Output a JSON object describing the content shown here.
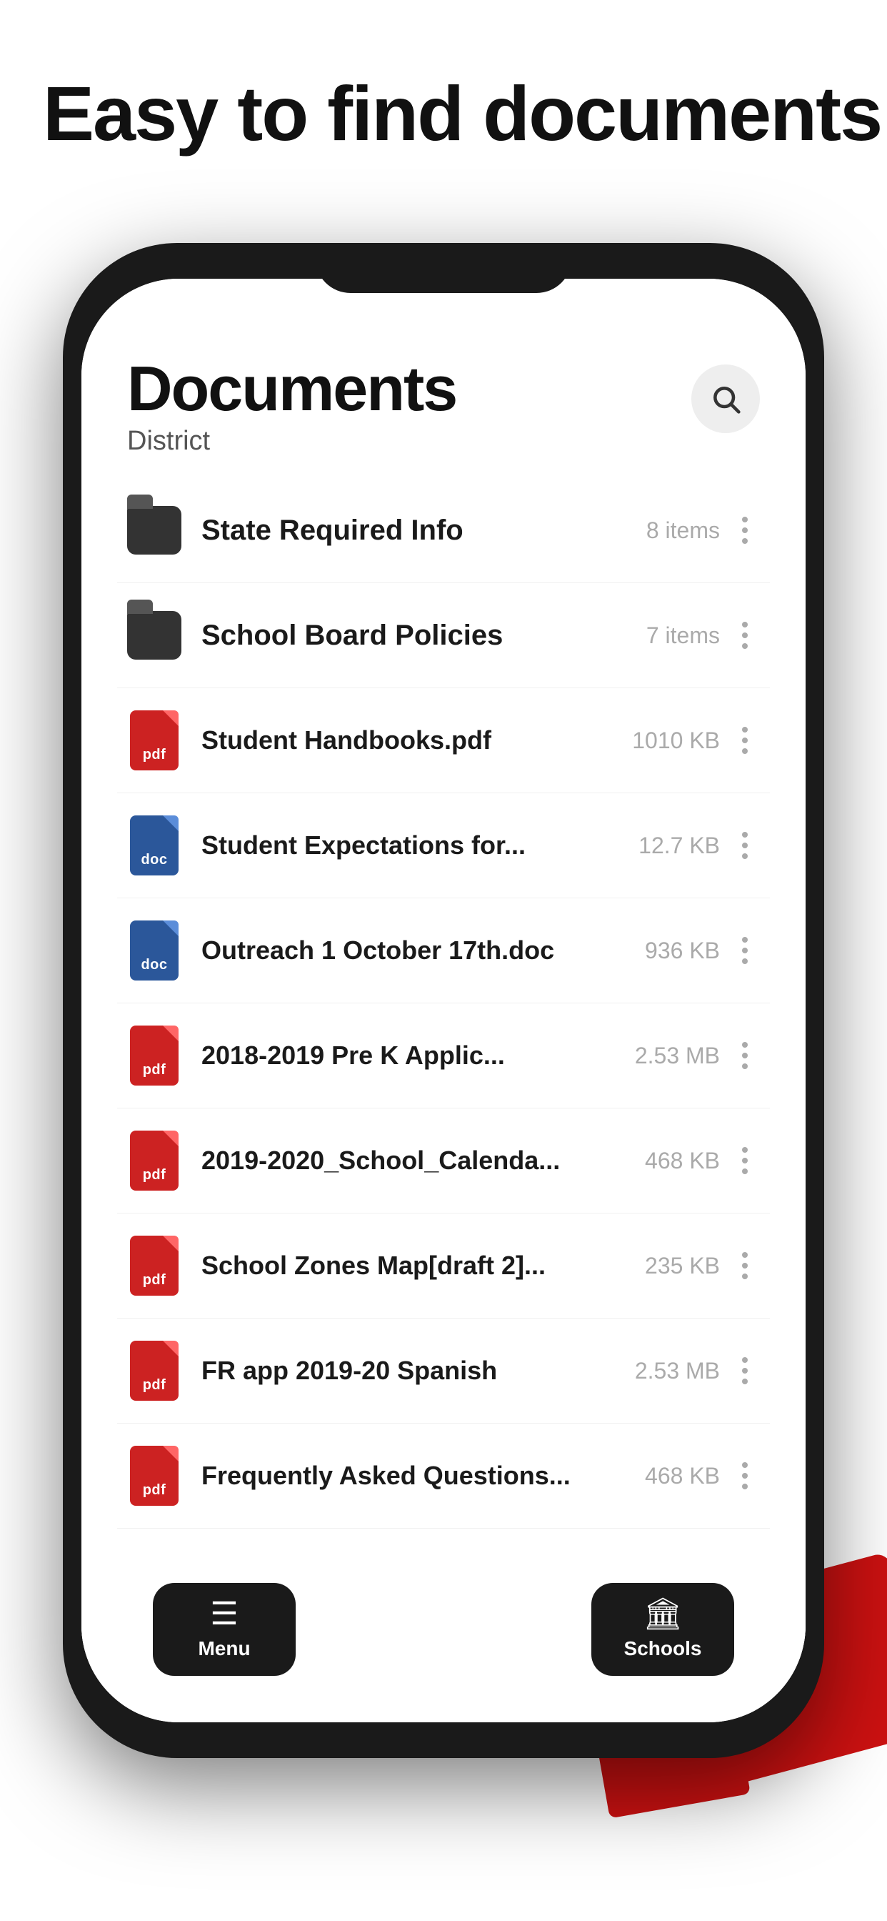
{
  "headline": "Easy to find documents",
  "phone": {
    "title": "Documents",
    "subtitle": "District",
    "items": [
      {
        "id": "folder-state",
        "type": "folder",
        "name": "State Required Info",
        "meta": "8 items"
      },
      {
        "id": "folder-school",
        "type": "folder",
        "name": "School Board Policies",
        "meta": "7 items"
      },
      {
        "id": "file-handbooks",
        "type": "pdf",
        "name": "Student Handbooks.pdf",
        "meta": "1010 KB"
      },
      {
        "id": "file-expectations",
        "type": "doc",
        "name": "Student Expectations for...",
        "meta": "12.7 KB"
      },
      {
        "id": "file-outreach",
        "type": "doc",
        "name": "Outreach 1 October 17th.doc",
        "meta": "936 KB"
      },
      {
        "id": "file-prek",
        "type": "pdf",
        "name": "2018-2019 Pre K Applic...",
        "meta": "2.53 MB"
      },
      {
        "id": "file-calendar",
        "type": "pdf",
        "name": "2019-2020_School_Calenda...",
        "meta": "468 KB"
      },
      {
        "id": "file-zones",
        "type": "pdf",
        "name": "School Zones Map[draft 2]...",
        "meta": "235 KB"
      },
      {
        "id": "file-frapp",
        "type": "pdf",
        "name": "FR app 2019-20 Spanish",
        "meta": "2.53 MB"
      },
      {
        "id": "file-faq",
        "type": "pdf",
        "name": "Frequently Asked Questions...",
        "meta": "468 KB"
      }
    ],
    "nav": {
      "menu_label": "Menu",
      "schools_label": "Schools"
    }
  },
  "icons": {
    "pdf_label": "pdf",
    "doc_label": "doc"
  }
}
